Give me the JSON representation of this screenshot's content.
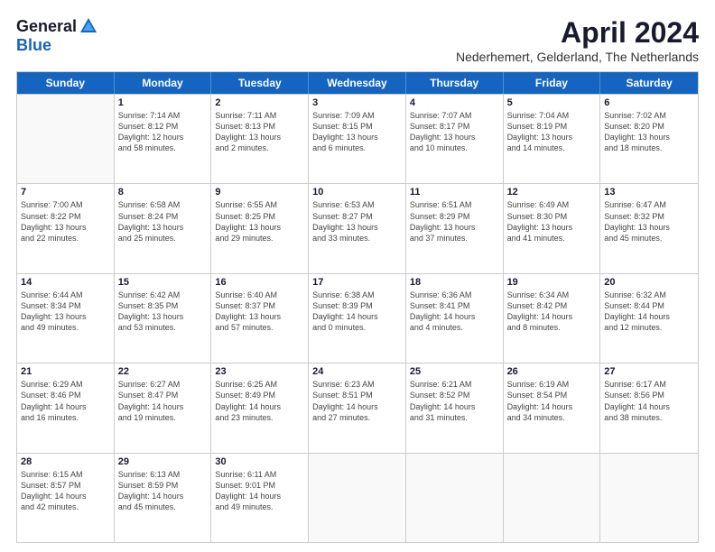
{
  "header": {
    "logo_general": "General",
    "logo_blue": "Blue",
    "month": "April 2024",
    "subtitle": "Nederhemert, Gelderland, The Netherlands"
  },
  "weekdays": [
    "Sunday",
    "Monday",
    "Tuesday",
    "Wednesday",
    "Thursday",
    "Friday",
    "Saturday"
  ],
  "rows": [
    [
      {
        "day": "",
        "lines": []
      },
      {
        "day": "1",
        "lines": [
          "Sunrise: 7:14 AM",
          "Sunset: 8:12 PM",
          "Daylight: 12 hours",
          "and 58 minutes."
        ]
      },
      {
        "day": "2",
        "lines": [
          "Sunrise: 7:11 AM",
          "Sunset: 8:13 PM",
          "Daylight: 13 hours",
          "and 2 minutes."
        ]
      },
      {
        "day": "3",
        "lines": [
          "Sunrise: 7:09 AM",
          "Sunset: 8:15 PM",
          "Daylight: 13 hours",
          "and 6 minutes."
        ]
      },
      {
        "day": "4",
        "lines": [
          "Sunrise: 7:07 AM",
          "Sunset: 8:17 PM",
          "Daylight: 13 hours",
          "and 10 minutes."
        ]
      },
      {
        "day": "5",
        "lines": [
          "Sunrise: 7:04 AM",
          "Sunset: 8:19 PM",
          "Daylight: 13 hours",
          "and 14 minutes."
        ]
      },
      {
        "day": "6",
        "lines": [
          "Sunrise: 7:02 AM",
          "Sunset: 8:20 PM",
          "Daylight: 13 hours",
          "and 18 minutes."
        ]
      }
    ],
    [
      {
        "day": "7",
        "lines": [
          "Sunrise: 7:00 AM",
          "Sunset: 8:22 PM",
          "Daylight: 13 hours",
          "and 22 minutes."
        ]
      },
      {
        "day": "8",
        "lines": [
          "Sunrise: 6:58 AM",
          "Sunset: 8:24 PM",
          "Daylight: 13 hours",
          "and 25 minutes."
        ]
      },
      {
        "day": "9",
        "lines": [
          "Sunrise: 6:55 AM",
          "Sunset: 8:25 PM",
          "Daylight: 13 hours",
          "and 29 minutes."
        ]
      },
      {
        "day": "10",
        "lines": [
          "Sunrise: 6:53 AM",
          "Sunset: 8:27 PM",
          "Daylight: 13 hours",
          "and 33 minutes."
        ]
      },
      {
        "day": "11",
        "lines": [
          "Sunrise: 6:51 AM",
          "Sunset: 8:29 PM",
          "Daylight: 13 hours",
          "and 37 minutes."
        ]
      },
      {
        "day": "12",
        "lines": [
          "Sunrise: 6:49 AM",
          "Sunset: 8:30 PM",
          "Daylight: 13 hours",
          "and 41 minutes."
        ]
      },
      {
        "day": "13",
        "lines": [
          "Sunrise: 6:47 AM",
          "Sunset: 8:32 PM",
          "Daylight: 13 hours",
          "and 45 minutes."
        ]
      }
    ],
    [
      {
        "day": "14",
        "lines": [
          "Sunrise: 6:44 AM",
          "Sunset: 8:34 PM",
          "Daylight: 13 hours",
          "and 49 minutes."
        ]
      },
      {
        "day": "15",
        "lines": [
          "Sunrise: 6:42 AM",
          "Sunset: 8:35 PM",
          "Daylight: 13 hours",
          "and 53 minutes."
        ]
      },
      {
        "day": "16",
        "lines": [
          "Sunrise: 6:40 AM",
          "Sunset: 8:37 PM",
          "Daylight: 13 hours",
          "and 57 minutes."
        ]
      },
      {
        "day": "17",
        "lines": [
          "Sunrise: 6:38 AM",
          "Sunset: 8:39 PM",
          "Daylight: 14 hours",
          "and 0 minutes."
        ]
      },
      {
        "day": "18",
        "lines": [
          "Sunrise: 6:36 AM",
          "Sunset: 8:41 PM",
          "Daylight: 14 hours",
          "and 4 minutes."
        ]
      },
      {
        "day": "19",
        "lines": [
          "Sunrise: 6:34 AM",
          "Sunset: 8:42 PM",
          "Daylight: 14 hours",
          "and 8 minutes."
        ]
      },
      {
        "day": "20",
        "lines": [
          "Sunrise: 6:32 AM",
          "Sunset: 8:44 PM",
          "Daylight: 14 hours",
          "and 12 minutes."
        ]
      }
    ],
    [
      {
        "day": "21",
        "lines": [
          "Sunrise: 6:29 AM",
          "Sunset: 8:46 PM",
          "Daylight: 14 hours",
          "and 16 minutes."
        ]
      },
      {
        "day": "22",
        "lines": [
          "Sunrise: 6:27 AM",
          "Sunset: 8:47 PM",
          "Daylight: 14 hours",
          "and 19 minutes."
        ]
      },
      {
        "day": "23",
        "lines": [
          "Sunrise: 6:25 AM",
          "Sunset: 8:49 PM",
          "Daylight: 14 hours",
          "and 23 minutes."
        ]
      },
      {
        "day": "24",
        "lines": [
          "Sunrise: 6:23 AM",
          "Sunset: 8:51 PM",
          "Daylight: 14 hours",
          "and 27 minutes."
        ]
      },
      {
        "day": "25",
        "lines": [
          "Sunrise: 6:21 AM",
          "Sunset: 8:52 PM",
          "Daylight: 14 hours",
          "and 31 minutes."
        ]
      },
      {
        "day": "26",
        "lines": [
          "Sunrise: 6:19 AM",
          "Sunset: 8:54 PM",
          "Daylight: 14 hours",
          "and 34 minutes."
        ]
      },
      {
        "day": "27",
        "lines": [
          "Sunrise: 6:17 AM",
          "Sunset: 8:56 PM",
          "Daylight: 14 hours",
          "and 38 minutes."
        ]
      }
    ],
    [
      {
        "day": "28",
        "lines": [
          "Sunrise: 6:15 AM",
          "Sunset: 8:57 PM",
          "Daylight: 14 hours",
          "and 42 minutes."
        ]
      },
      {
        "day": "29",
        "lines": [
          "Sunrise: 6:13 AM",
          "Sunset: 8:59 PM",
          "Daylight: 14 hours",
          "and 45 minutes."
        ]
      },
      {
        "day": "30",
        "lines": [
          "Sunrise: 6:11 AM",
          "Sunset: 9:01 PM",
          "Daylight: 14 hours",
          "and 49 minutes."
        ]
      },
      {
        "day": "",
        "lines": []
      },
      {
        "day": "",
        "lines": []
      },
      {
        "day": "",
        "lines": []
      },
      {
        "day": "",
        "lines": []
      }
    ]
  ]
}
